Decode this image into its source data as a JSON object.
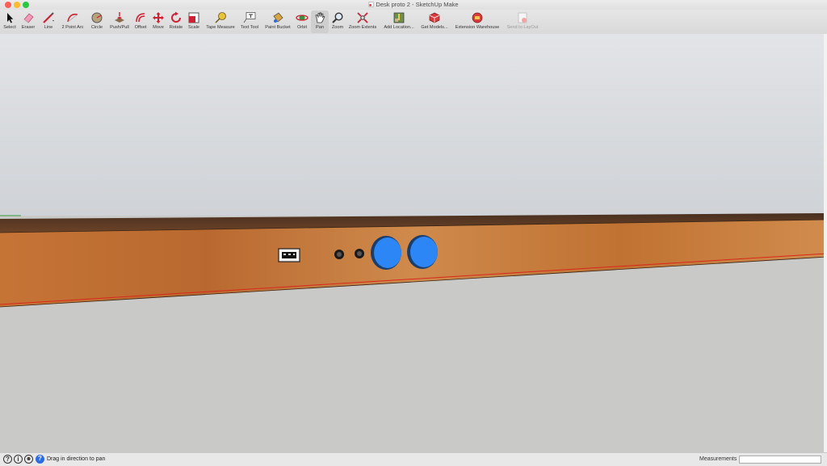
{
  "window": {
    "title": "Desk proto 2 - SketchUp Make"
  },
  "toolbar": {
    "tools": [
      {
        "id": "select",
        "label": "Select"
      },
      {
        "id": "eraser",
        "label": "Eraser"
      },
      {
        "id": "line",
        "label": "Line"
      },
      {
        "id": "arc",
        "label": "2 Point Arc"
      },
      {
        "id": "circle",
        "label": "Circle"
      },
      {
        "id": "pushpull",
        "label": "Push/Pull"
      },
      {
        "id": "offset",
        "label": "Offset"
      },
      {
        "id": "move",
        "label": "Move"
      },
      {
        "id": "rotate",
        "label": "Rotate"
      },
      {
        "id": "scale",
        "label": "Scale"
      },
      {
        "id": "tape",
        "label": "Tape Measure"
      },
      {
        "id": "text",
        "label": "Text Tool"
      },
      {
        "id": "paint",
        "label": "Paint Bucket"
      },
      {
        "id": "orbit",
        "label": "Orbit"
      },
      {
        "id": "pan",
        "label": "Pan",
        "active": true
      },
      {
        "id": "zoom",
        "label": "Zoom"
      },
      {
        "id": "zoomext",
        "label": "Zoom Extents"
      },
      {
        "id": "addloc",
        "label": "Add Location..."
      },
      {
        "id": "getmodels",
        "label": "Get Models..."
      },
      {
        "id": "extwh",
        "label": "Extension Warehouse"
      },
      {
        "id": "layout",
        "label": "Send to LayOut",
        "disabled": true
      }
    ]
  },
  "status": {
    "message": "Drag in direction to pan",
    "measurements_label": "Measurements",
    "measurements_value": ""
  },
  "scene": {
    "sky_color": "#d3d6da",
    "ground_color": "#c9c9c7",
    "wood_color": "#c4733a",
    "knob_color": "#2d86f5"
  }
}
